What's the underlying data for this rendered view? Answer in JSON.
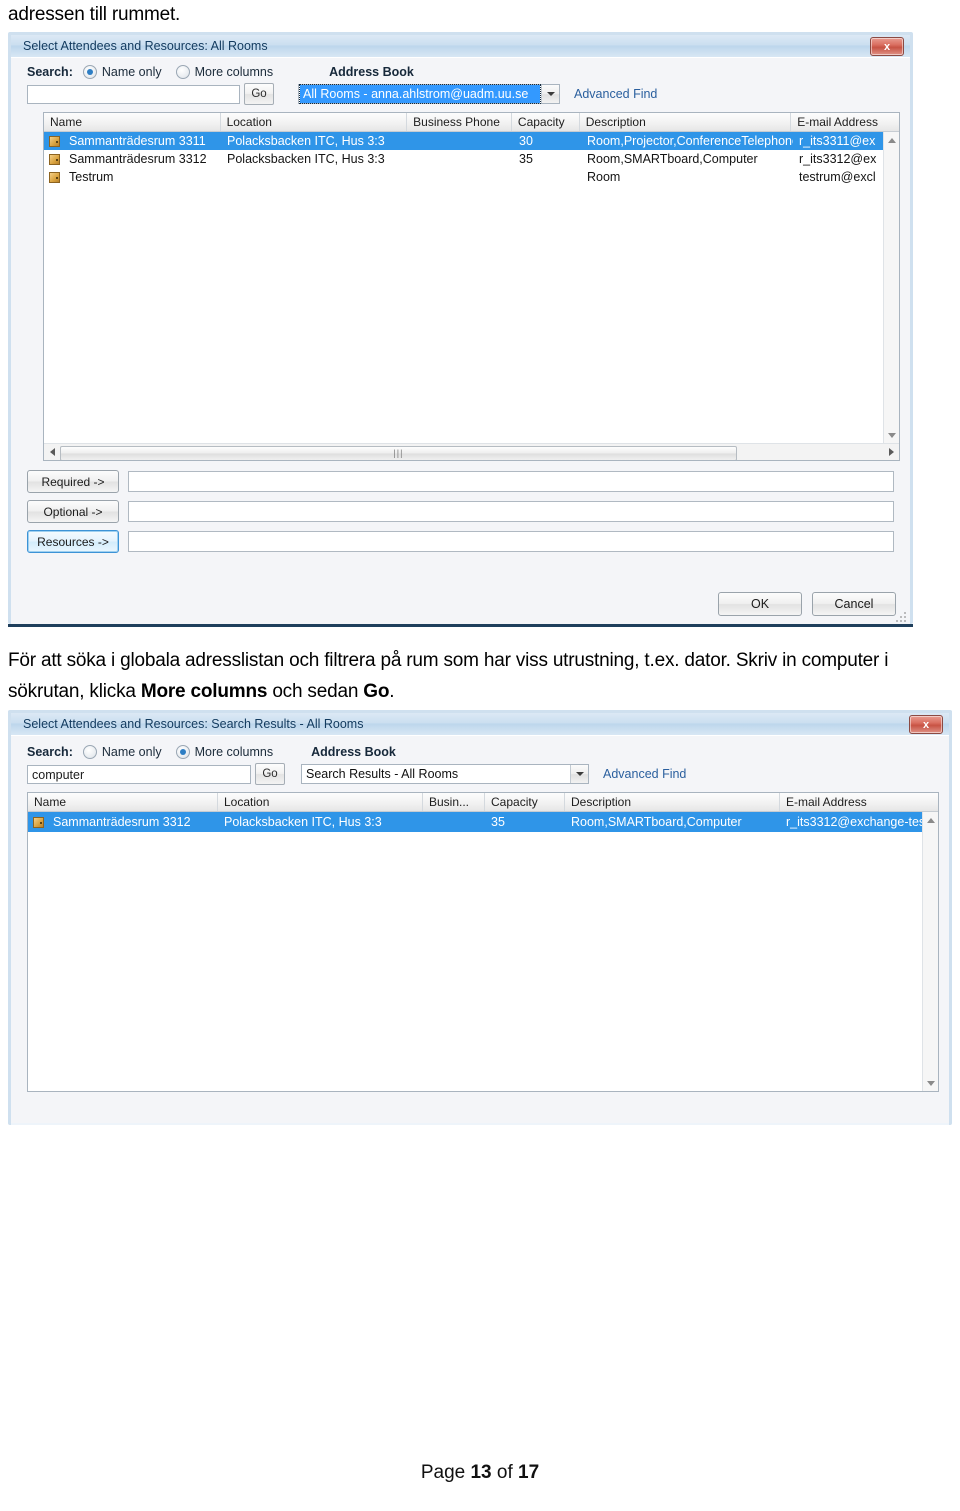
{
  "document": {
    "intro_text": "adressen till rummet.",
    "paragraph_html": "För att söka i globala adresslistan och filtrera på rum som har viss utrustning, t.ex. dator. Skriv in computer i sökrutan, klicka <b>More columns</b> och sedan <b>Go</b>.",
    "footer": "Page 13 of 17",
    "footer_prefix": "Page ",
    "footer_page": "13",
    "footer_middle": " of ",
    "footer_total": "17"
  },
  "dialog1": {
    "title": "Select Attendees and Resources: All Rooms",
    "close_label": "x",
    "search": {
      "label": "Search:",
      "option_name_only": "Name only",
      "option_more_columns": "More columns",
      "selected_option": "Name only",
      "input_value": "",
      "input_placeholder": "",
      "go_label": "Go"
    },
    "address_book": {
      "label": "Address Book",
      "selected": "All Rooms - anna.ahlstrom@uadm.uu.se",
      "advanced_find": "Advanced Find"
    },
    "columns": [
      "Name",
      "Location",
      "Business Phone",
      "Capacity",
      "Description",
      "E-mail Address"
    ],
    "rows": [
      {
        "name": "Sammanträdesrum 3311",
        "location": "Polacksbacken ITC, Hus 3:3",
        "business_phone": "",
        "capacity": "30",
        "description": "Room,Projector,ConferenceTelephone",
        "email": "r_its3311@ex",
        "selected": true
      },
      {
        "name": "Sammanträdesrum 3312",
        "location": "Polacksbacken ITC, Hus 3:3",
        "business_phone": "",
        "capacity": "35",
        "description": "Room,SMARTboard,Computer",
        "email": "r_its3312@ex",
        "selected": false
      },
      {
        "name": "Testrum",
        "location": "",
        "business_phone": "",
        "capacity": "",
        "description": "Room",
        "email": "testrum@excl",
        "selected": false
      }
    ],
    "attendees": [
      {
        "button": "Required ->",
        "value": "",
        "focused": false
      },
      {
        "button": "Optional ->",
        "value": "",
        "focused": false
      },
      {
        "button": "Resources ->",
        "value": "",
        "focused": true
      }
    ],
    "ok_label": "OK",
    "cancel_label": "Cancel"
  },
  "dialog2": {
    "title": "Select Attendees and Resources: Search Results - All Rooms",
    "close_label": "x",
    "search": {
      "label": "Search:",
      "option_name_only": "Name only",
      "option_more_columns": "More columns",
      "selected_option": "More columns",
      "input_value": "computer",
      "input_placeholder": "",
      "go_label": "Go"
    },
    "address_book": {
      "label": "Address Book",
      "selected": "Search Results - All Rooms",
      "advanced_find": "Advanced Find"
    },
    "columns": [
      "Name",
      "Location",
      "Busin...",
      "Capacity",
      "Description",
      "E-mail Address"
    ],
    "rows": [
      {
        "name": "Sammanträdesrum 3312",
        "location": "Polacksbacken ITC, Hus 3:3",
        "business_phone": "",
        "capacity": "35",
        "description": "Room,SMARTboard,Computer",
        "email": "r_its3312@exchange-tes",
        "selected": true
      }
    ]
  },
  "colors": {
    "selection_blue": "#2f95e8",
    "title_blue": "#bdd6ec",
    "link_blue": "#2a5f9e",
    "close_red": "#c75344"
  }
}
